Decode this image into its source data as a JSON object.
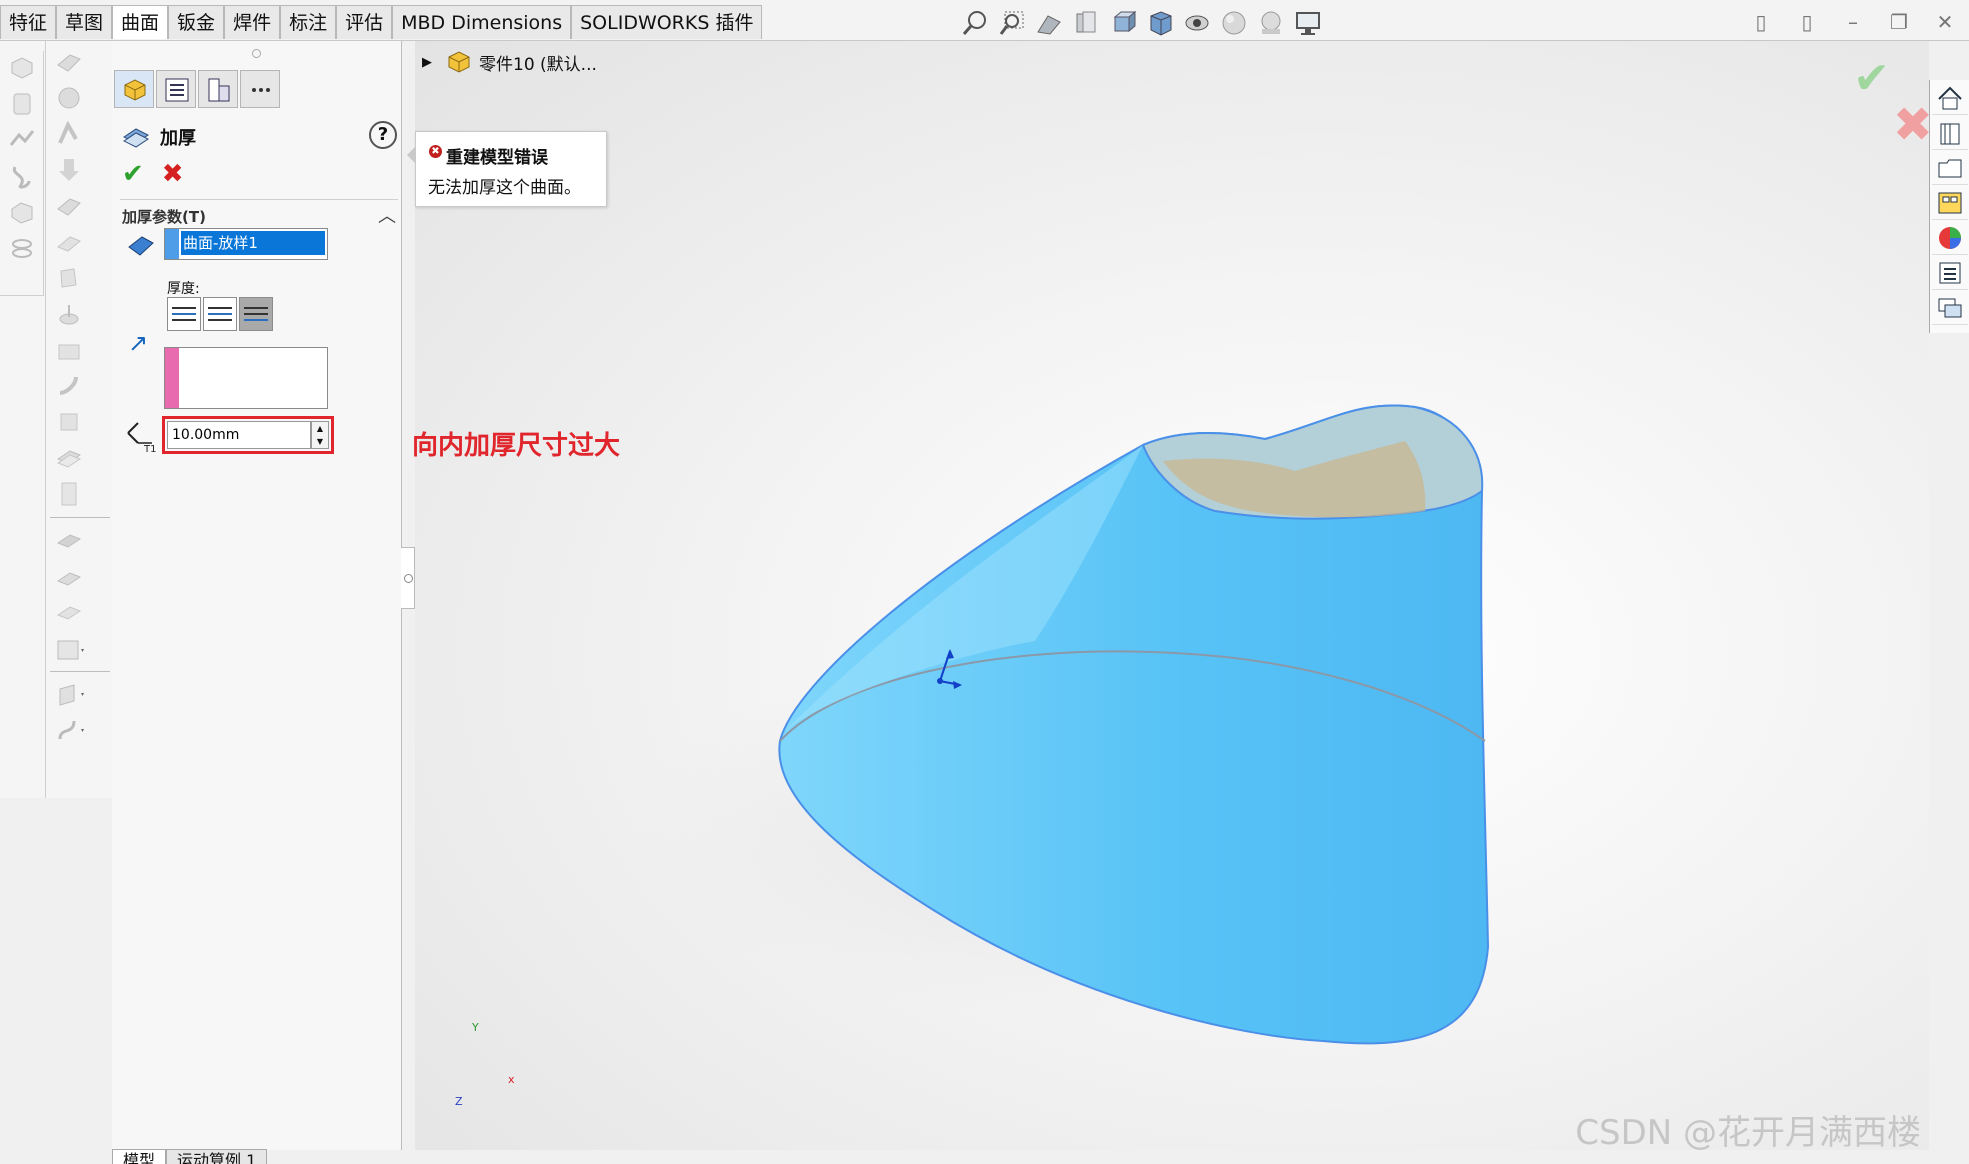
{
  "ribbon": {
    "tabs": [
      {
        "label": "特征",
        "active": false
      },
      {
        "label": "草图",
        "active": false
      },
      {
        "label": "曲面",
        "active": true
      },
      {
        "label": "钣金",
        "active": false
      },
      {
        "label": "焊件",
        "active": false
      },
      {
        "label": "标注",
        "active": false
      },
      {
        "label": "评估",
        "active": false
      },
      {
        "label": "MBD Dimensions",
        "active": false
      },
      {
        "label": "SOLIDWORKS 插件",
        "active": false
      }
    ]
  },
  "property_manager": {
    "title": "加厚",
    "help_label": "?",
    "ok_label": "✔",
    "cancel_label": "✖",
    "group_label": "加厚参数(T)",
    "selected_face": "曲面-放样1",
    "thickness_label": "厚度:",
    "thickness_value": "10.00mm",
    "thickness_options": [
      "side-1",
      "both-sides",
      "side-2"
    ],
    "selected_thickness_option": "side-2"
  },
  "viewport": {
    "tree_part": "零件10 (默认...",
    "error_title": "重建模型错误",
    "error_message": "无法加厚这个曲面。",
    "annotation": "向内加厚尺寸过大",
    "watermark": "CSDN @花开月满西楼",
    "axis_labels": {
      "x": "x",
      "y": "Y",
      "z": "Z"
    }
  },
  "bottom_tabs": [
    {
      "label": "模型",
      "active": true
    },
    {
      "label": "运动算例 1",
      "active": false
    }
  ],
  "colors": {
    "model_fill": "#62c6f5",
    "model_edge": "#4a8fe8",
    "annotation_red": "#e0262c",
    "selection_blue": "#0a76d8"
  }
}
